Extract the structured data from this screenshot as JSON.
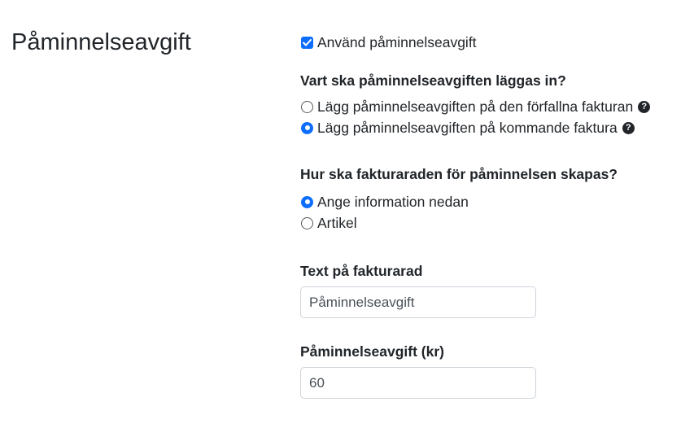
{
  "section": {
    "title": "Påminnelseavgift"
  },
  "use_fee": {
    "label": "Använd påminnelseavgift",
    "checked": true
  },
  "placement": {
    "question": "Vart ska påminnelseavgiften läggas in?",
    "options": [
      {
        "label": "Lägg påminnelseavgiften på den förfallna fakturan",
        "selected": false,
        "help_icon": "question-circle-icon"
      },
      {
        "label": "Lägg påminnelseavgiften på kommande faktura",
        "selected": true,
        "help_icon": "question-circle-icon"
      }
    ]
  },
  "row_creation": {
    "question": "Hur ska fakturaraden för påminnelsen skapas?",
    "options": [
      {
        "label": "Ange information nedan",
        "selected": true
      },
      {
        "label": "Artikel",
        "selected": false
      }
    ]
  },
  "row_text": {
    "label": "Text på fakturarad",
    "value": "Påminnelseavgift"
  },
  "fee_amount": {
    "label": "Påminnelseavgift (kr)",
    "value": "60"
  },
  "colors": {
    "accent": "#0d6efd",
    "text": "#212529",
    "border": "#ced4da"
  }
}
